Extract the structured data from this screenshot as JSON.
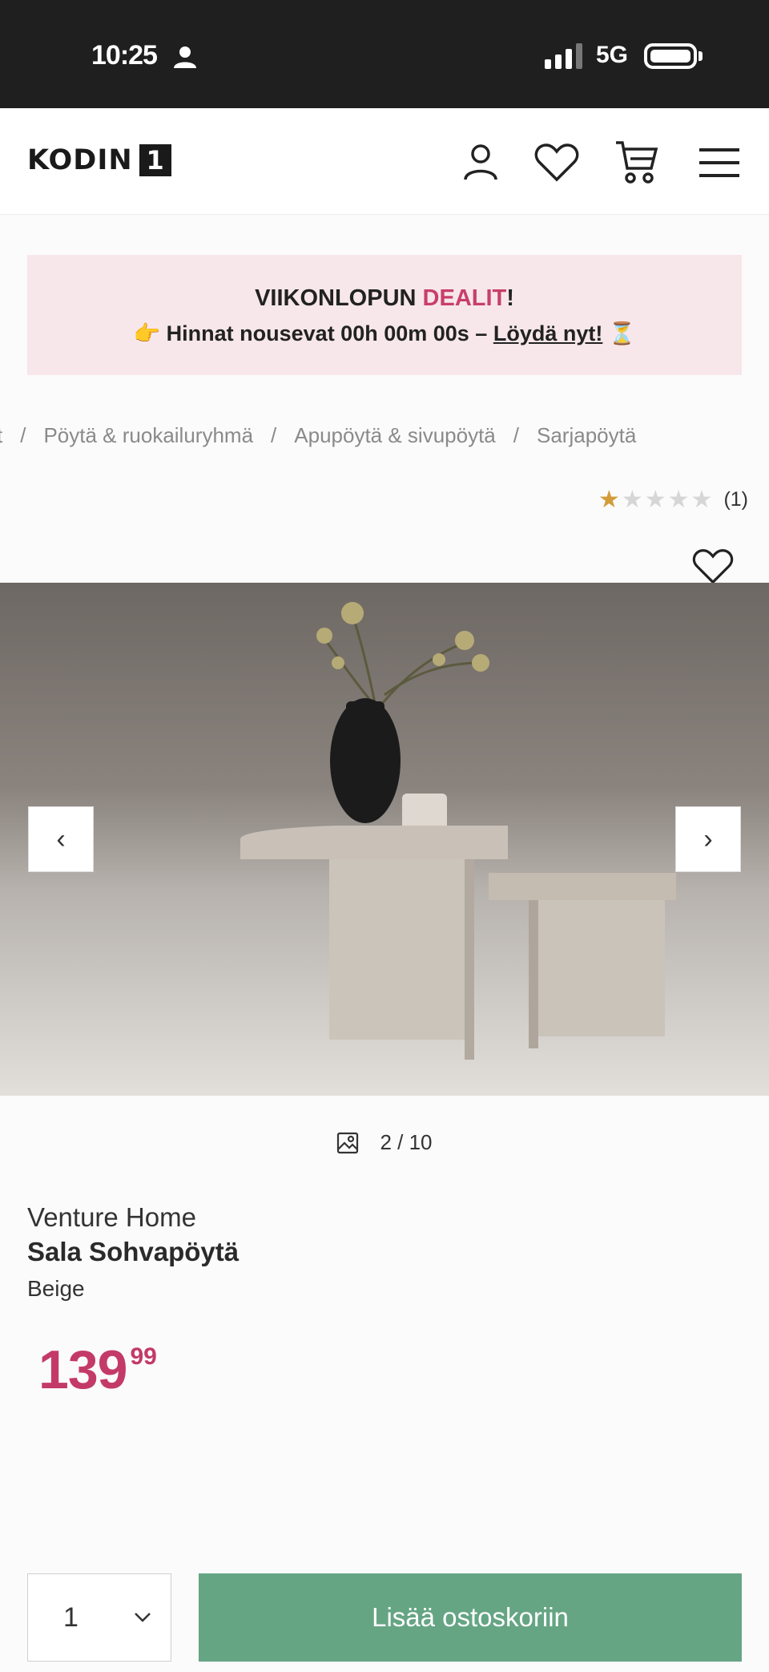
{
  "status_bar": {
    "time": "10:25",
    "network": "5G"
  },
  "header": {
    "logo_text": "KODIN",
    "logo_number": "1",
    "icons": [
      "account-icon",
      "wishlist-icon",
      "cart-icon",
      "menu-icon"
    ]
  },
  "promo": {
    "title_plain": "VIIKONLOPUN ",
    "title_accent": "DEALIT",
    "title_end": "!",
    "emoji_left": "👉",
    "countdown_text": "Hinnat nousevat 00h 00m 00s – ",
    "link_text": "Löydä nyt!",
    "emoji_right": "⏳",
    "accent_color": "#c93f6a"
  },
  "breadcrumb": [
    "t",
    "Pöytä & ruokailuryhmä",
    "Apupöytä & sivupöytä",
    "Sarjapöytä"
  ],
  "rating": {
    "stars": 1,
    "max": 5,
    "count_text": "(1)"
  },
  "gallery": {
    "counter": "2 / 10",
    "prev": "‹",
    "next": "›"
  },
  "product": {
    "brand": "Venture Home",
    "name": "Sala Sohvapöytä",
    "variant": "Beige",
    "price_main": "139",
    "price_cents": "99",
    "price_color": "#c33a68"
  },
  "cart": {
    "quantity": "1",
    "add_label": "Lisää ostoskoriin",
    "button_color": "#65a584"
  }
}
